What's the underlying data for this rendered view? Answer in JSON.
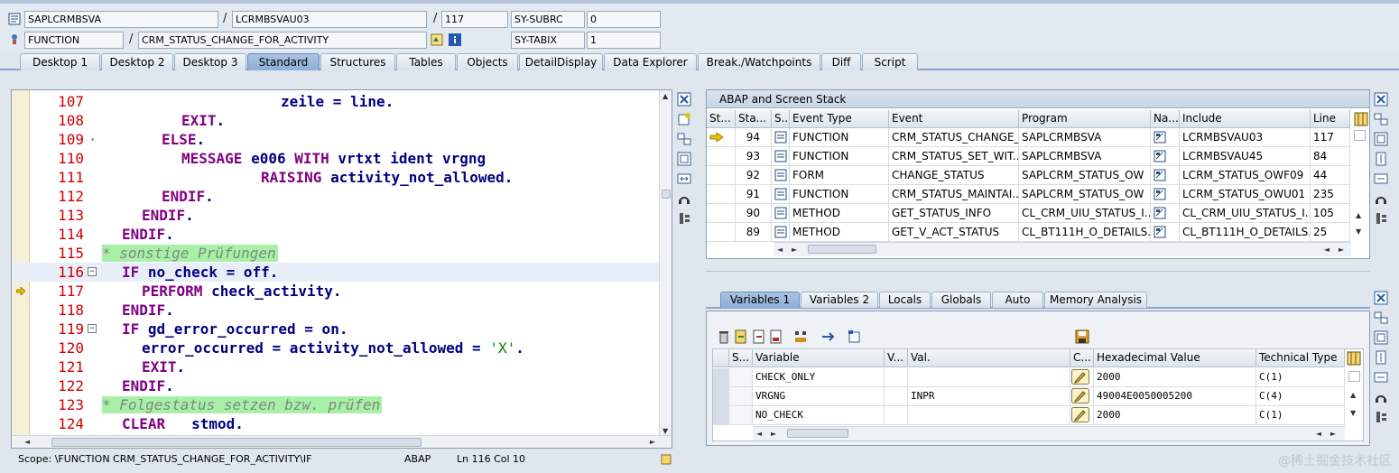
{
  "header": {
    "program": "SAPLCRMBSVA",
    "include": "LCRMBSVAU03",
    "line": "117",
    "subrc_label": "SY-SUBRC",
    "subrc_value": "0",
    "event_type": "FUNCTION",
    "event_name": "CRM_STATUS_CHANGE_FOR_ACTIVITY",
    "tabix_label": "SY-TABIX",
    "tabix_value": "1",
    "sep": "/"
  },
  "tabs": [
    "Desktop 1",
    "Desktop 2",
    "Desktop 3",
    "Standard",
    "Structures",
    "Tables",
    "Objects",
    "DetailDisplay",
    "Data Explorer",
    "Break./Watchpoints",
    "Diff",
    "Script"
  ],
  "editor": {
    "lines": [
      {
        "no": "107",
        "code": "                   zeile = line."
      },
      {
        "no": "108",
        "code": "         EXIT."
      },
      {
        "no": "109",
        "code": "       ELSE."
      },
      {
        "no": "110",
        "code": "         MESSAGE e006 WITH vrtxt ident vrgng"
      },
      {
        "no": "111",
        "code": "                 RAISING activity_not_allowed."
      },
      {
        "no": "112",
        "code": "       ENDIF."
      },
      {
        "no": "113",
        "code": "     ENDIF."
      },
      {
        "no": "114",
        "code": "   ENDIF."
      },
      {
        "no": "115",
        "code": " * sonstige Prüfungen"
      },
      {
        "no": "116",
        "code": "   IF no_check = off."
      },
      {
        "no": "117",
        "code": "     PERFORM check_activity."
      },
      {
        "no": "118",
        "code": "   ENDIF."
      },
      {
        "no": "119",
        "code": "   IF gd_error_occurred = on."
      },
      {
        "no": "120",
        "code": "     error_occurred = activity_not_allowed = 'X'."
      },
      {
        "no": "121",
        "code": "     EXIT."
      },
      {
        "no": "122",
        "code": "   ENDIF."
      },
      {
        "no": "123",
        "code": " * Folgestatus setzen bzw. prüfen"
      },
      {
        "no": "124",
        "code": "   CLEAR   stmod."
      }
    ],
    "scope": "Scope: \\FUNCTION CRM_STATUS_CHANGE_FOR_ACTIVITY\\IF",
    "language": "ABAP",
    "cursor": "Ln 116 Col  10"
  },
  "stack": {
    "title": "ABAP and Screen Stack",
    "columns": [
      "St...",
      "Sta...",
      "S...",
      "Event Type",
      "Event",
      "Program",
      "Na...",
      "Include",
      "Line"
    ],
    "rows": [
      {
        "level": "94",
        "type": "FUNCTION",
        "event": "CRM_STATUS_CHANGE_...",
        "program": "SAPLCRMBSVA",
        "include": "LCRMBSVAU03",
        "line": "117",
        "current": true
      },
      {
        "level": "93",
        "type": "FUNCTION",
        "event": "CRM_STATUS_SET_WIT...",
        "program": "SAPLCRMBSVA",
        "include": "LCRMBSVAU45",
        "line": "84",
        "current": false
      },
      {
        "level": "92",
        "type": "FORM",
        "event": "CHANGE_STATUS",
        "program": "SAPLCRM_STATUS_OW",
        "include": "LCRM_STATUS_OWF09",
        "line": "44",
        "current": false
      },
      {
        "level": "91",
        "type": "FUNCTION",
        "event": "CRM_STATUS_MAINTAI...",
        "program": "SAPLCRM_STATUS_OW",
        "include": "LCRM_STATUS_OWU01",
        "line": "235",
        "current": false
      },
      {
        "level": "90",
        "type": "METHOD",
        "event": "GET_STATUS_INFO",
        "program": "CL_CRM_UIU_STATUS_I...",
        "include": "CL_CRM_UIU_STATUS_I...",
        "line": "105",
        "current": false
      },
      {
        "level": "89",
        "type": "METHOD",
        "event": "GET_V_ACT_STATUS",
        "program": "CL_BT111H_O_DETAILS...",
        "include": "CL_BT111H_O_DETAILS...",
        "line": "25",
        "current": false
      }
    ]
  },
  "vartabs": [
    "Variables 1",
    "Variables 2",
    "Locals",
    "Globals",
    "Auto",
    "Memory Analysis"
  ],
  "vars": {
    "columns": [
      "S...",
      "Variable",
      "V...",
      "Val.",
      "C...",
      "Hexadecimal Value",
      "Technical Type"
    ],
    "rows": [
      {
        "name": "CHECK_ONLY",
        "val": "",
        "hex": "2000",
        "type": "C(1)"
      },
      {
        "name": "VRGNG",
        "val": "INPR",
        "hex": "49004E0050005200",
        "type": "C(4)"
      },
      {
        "name": "NO_CHECK",
        "val": "",
        "hex": "2000",
        "type": "C(1)"
      }
    ]
  },
  "watermark": "@稀土掘金技术社区"
}
